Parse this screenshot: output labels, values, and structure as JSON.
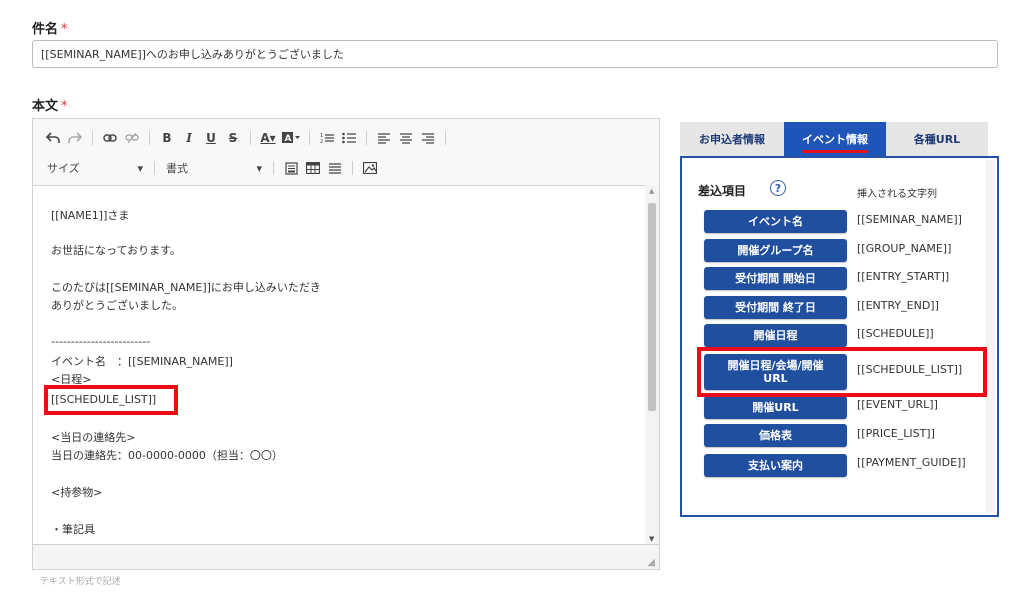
{
  "subject": {
    "label": "件名",
    "required_mark": "*",
    "value": "[[SEMINAR_NAME]]へのお申し込みありがとうございました"
  },
  "body": {
    "label": "本文",
    "required_mark": "*",
    "toolbar": {
      "size_label": "サイズ",
      "format_label": "書式"
    },
    "lines": [
      "[[NAME1]]さま",
      "お世話になっております。",
      "このたびは[[SEMINAR_NAME]]にお申し込みいただき",
      "ありがとうございました。",
      "-------------------------",
      "イベント名　：[[SEMINAR_NAME]]",
      "<日程>",
      "[[SCHEDULE_LIST]]",
      "<当日の連絡先>",
      "当日の連絡先：00-0000-0000（担当：〇〇）",
      "<持参物>",
      "・筆記具"
    ],
    "hint": "テキスト形式で記述"
  },
  "tabs": [
    {
      "label": "お申込者情報",
      "active": false
    },
    {
      "label": "イベント情報",
      "active": true
    },
    {
      "label": "各種URL",
      "active": false
    }
  ],
  "variables": {
    "heading": "差込項目",
    "help_icon": "question-circle-icon",
    "column_label": "挿入される文字列",
    "items": [
      {
        "label": "イベント名",
        "value": "[[SEMINAR_NAME]]"
      },
      {
        "label": "開催グループ名",
        "value": "[[GROUP_NAME]]"
      },
      {
        "label": "受付期間 開始日",
        "value": "[[ENTRY_START]]"
      },
      {
        "label": "受付期間 終了日",
        "value": "[[ENTRY_END]]"
      },
      {
        "label": "開催日程",
        "value": "[[SCHEDULE]]"
      },
      {
        "label": "開催日程/会場/開催URL",
        "value": "[[SCHEDULE_LIST]]"
      },
      {
        "label": "開催URL",
        "value": "[[EVENT_URL]]"
      },
      {
        "label": "価格表",
        "value": "[[PRICE_LIST]]"
      },
      {
        "label": "支払い案内",
        "value": "[[PAYMENT_GUIDE]]"
      }
    ]
  },
  "colors": {
    "accent": "#1f55b8",
    "button": "#1f4f9e",
    "highlight": "#ee0b18",
    "required": "#e0303a"
  }
}
